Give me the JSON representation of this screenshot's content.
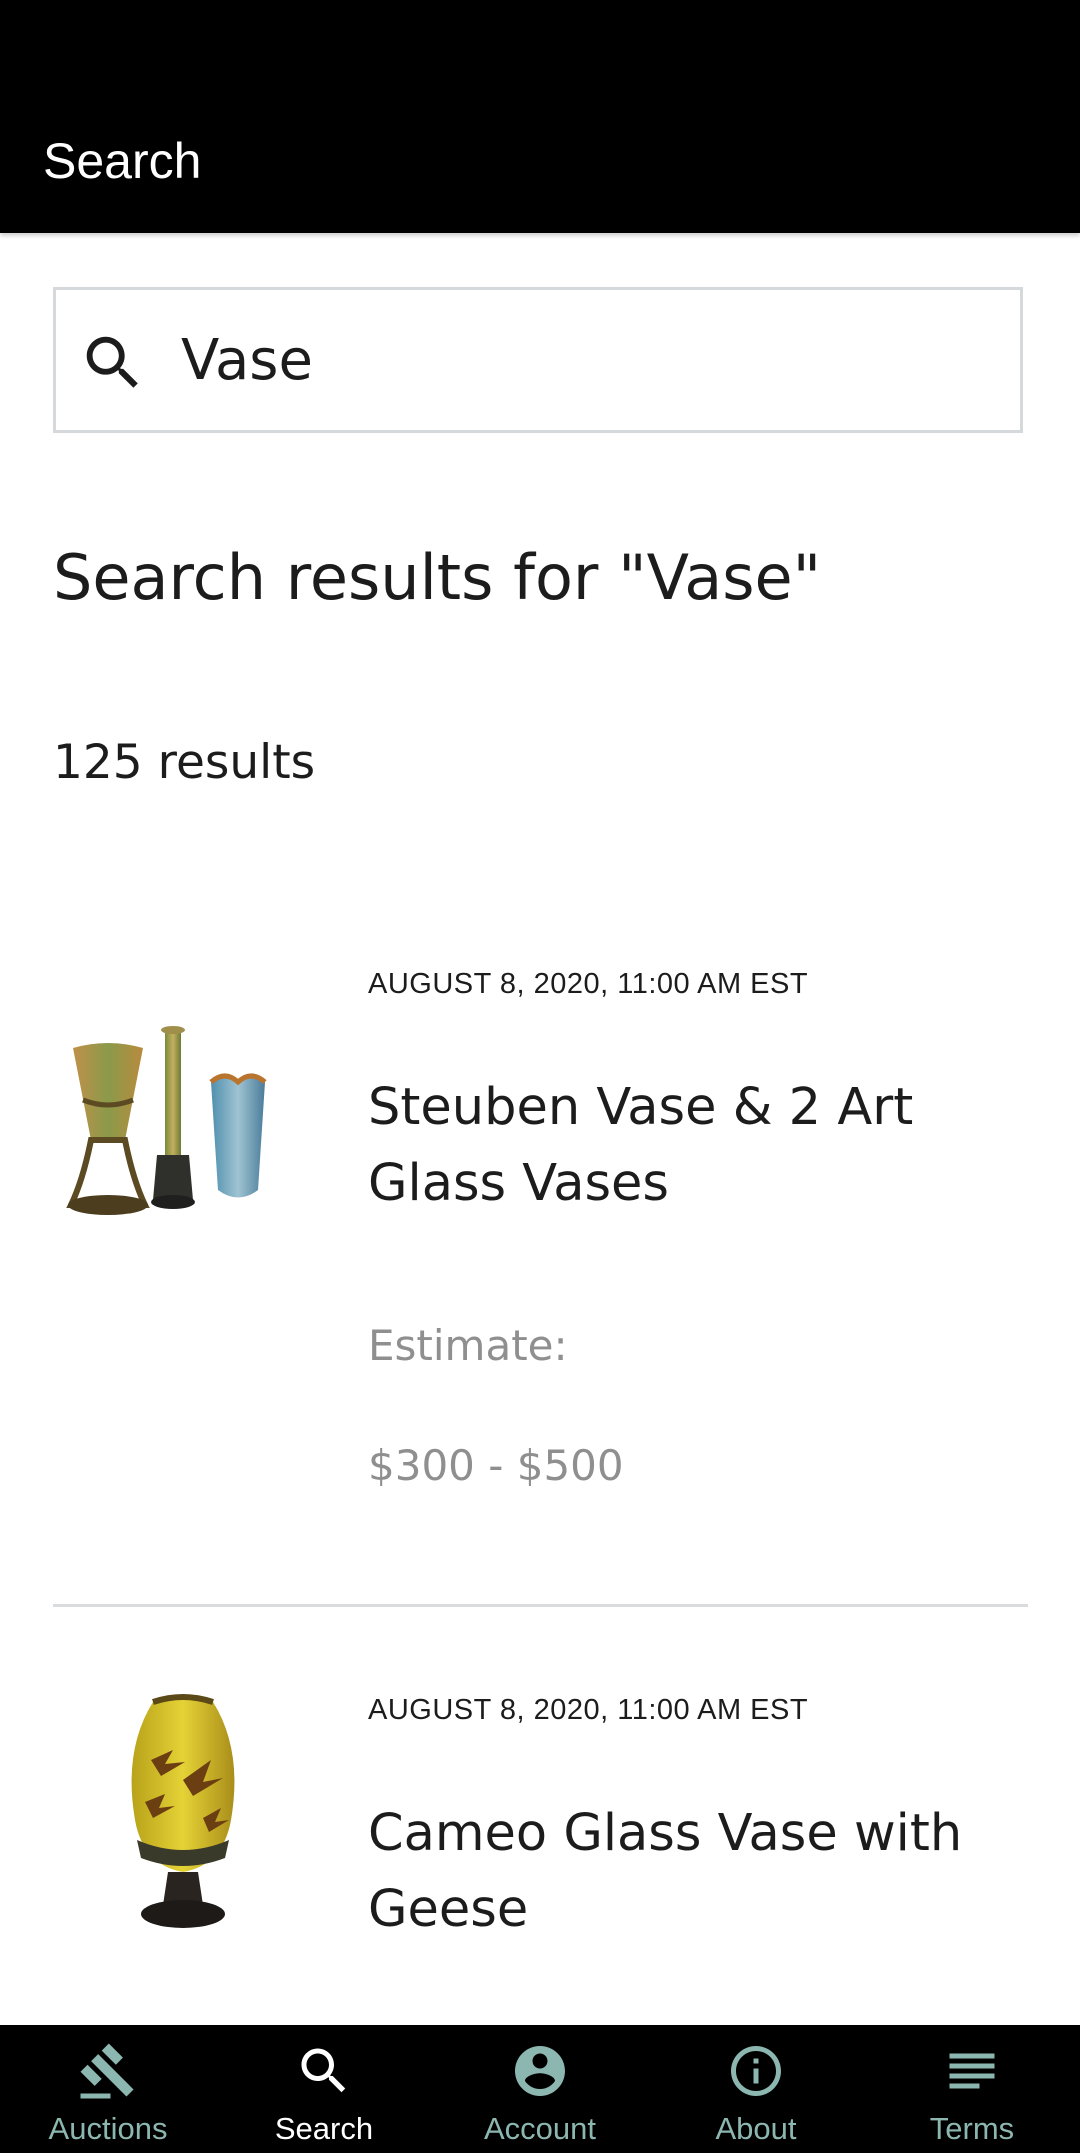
{
  "header": {
    "title": "Search"
  },
  "search": {
    "value": "Vase",
    "icon": "search-icon"
  },
  "results": {
    "heading": "Search results for \"Vase\"",
    "count": "125 results",
    "items": [
      {
        "date": "AUGUST 8, 2020, 11:00 AM EST",
        "title": "Steuben Vase & 2 Art Glass Vases",
        "estimate_label": "Estimate:",
        "estimate_value": "$300 - $500"
      },
      {
        "date": "AUGUST 8, 2020, 11:00 AM EST",
        "title": "Cameo Glass Vase with Geese"
      }
    ]
  },
  "nav": {
    "items": [
      {
        "label": "Auctions",
        "icon": "gavel-icon",
        "active": false
      },
      {
        "label": "Search",
        "icon": "search-icon",
        "active": true
      },
      {
        "label": "Account",
        "icon": "account-icon",
        "active": false
      },
      {
        "label": "About",
        "icon": "info-icon",
        "active": false
      },
      {
        "label": "Terms",
        "icon": "terms-icon",
        "active": false
      }
    ]
  },
  "colors": {
    "header_bg": "#000000",
    "nav_inactive": "#8cb6b0",
    "nav_active": "#ffffff",
    "muted_text": "#8f8f8f"
  }
}
